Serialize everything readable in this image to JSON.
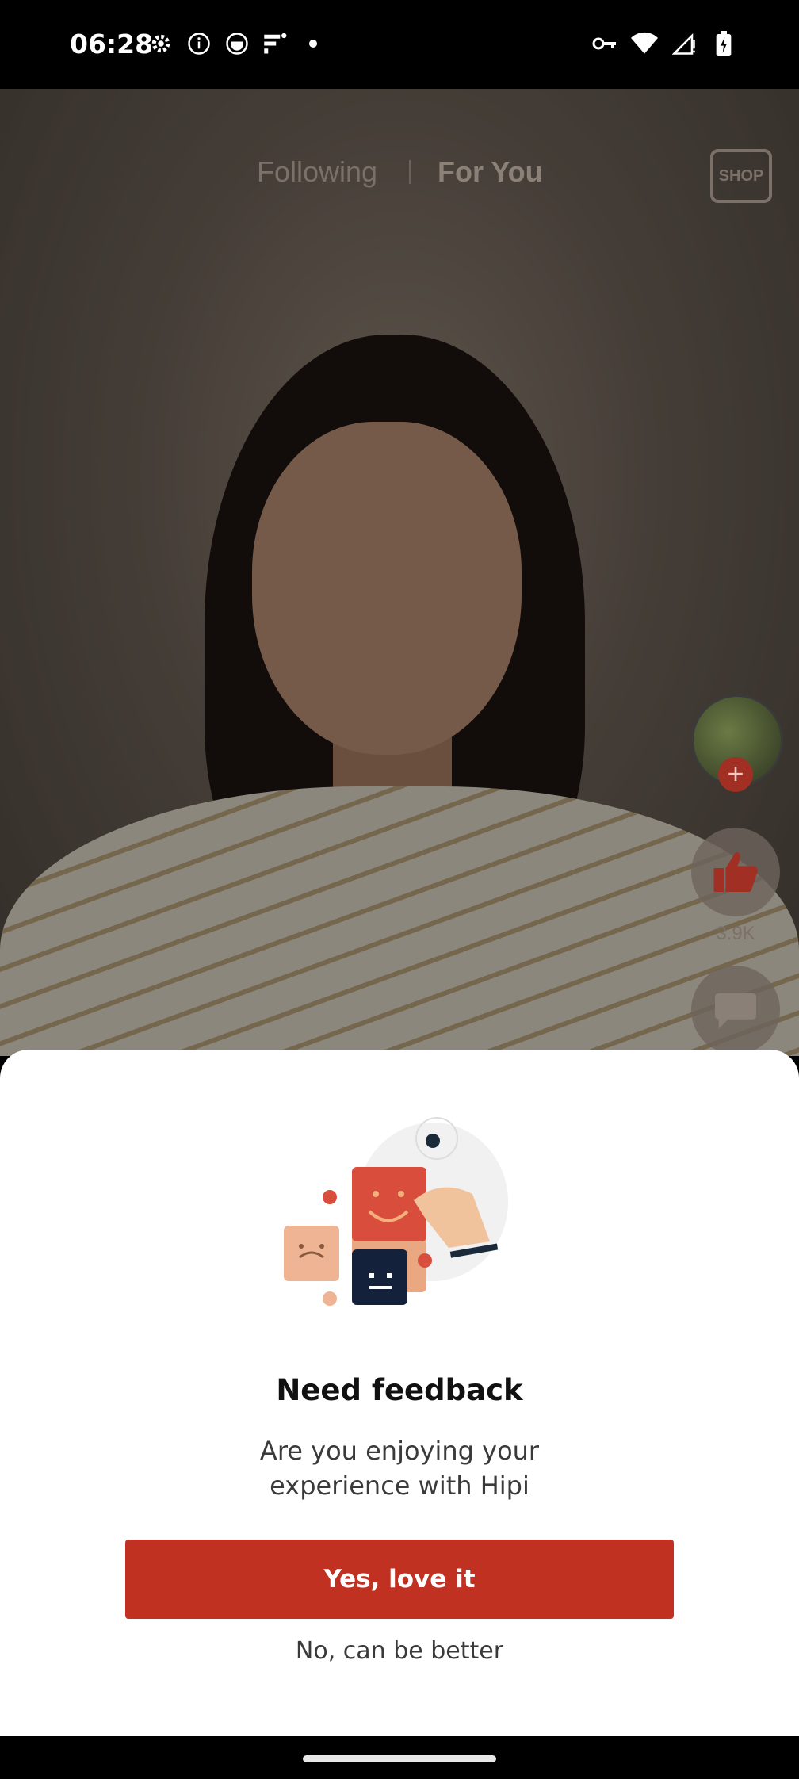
{
  "status_bar": {
    "time": "06:28",
    "left_icons": [
      "settings-icon",
      "info-icon",
      "app-icon",
      "cast-icon",
      "dot-icon"
    ],
    "right_icons": [
      "vpn-key-icon",
      "wifi-icon",
      "signal-icon",
      "battery-icon"
    ]
  },
  "feed": {
    "tabs": [
      {
        "label": "Following",
        "active": false
      },
      {
        "label": "For You",
        "active": true
      }
    ],
    "shop_label": "SHOP",
    "like_count": "3.9K"
  },
  "feedback_sheet": {
    "title": "Need feedback",
    "body": "Are you enjoying your experience with Hipi",
    "primary_button": "Yes, love it",
    "secondary_button": "No, can be better"
  },
  "colors": {
    "accent": "#c13122",
    "sheet_background": "#ffffff",
    "status_bar": "#000000"
  }
}
